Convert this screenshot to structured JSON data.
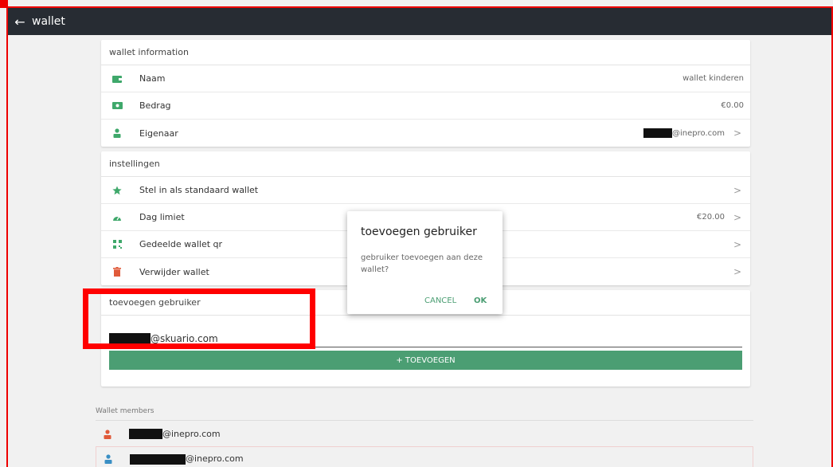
{
  "header": {
    "back_icon": "arrow-left-icon",
    "title": "wallet"
  },
  "wallet_info": {
    "title": "wallet information",
    "rows": [
      {
        "icon": "wallet-icon",
        "label": "Naam",
        "value": "wallet kinderen"
      },
      {
        "icon": "money-icon",
        "label": "Bedrag",
        "value": "€0.00"
      },
      {
        "icon": "user-icon",
        "label": "Eigenaar",
        "value": "@inepro.com",
        "chevron": ">"
      }
    ]
  },
  "settings": {
    "title": "instellingen",
    "rows": [
      {
        "icon": "star-icon",
        "label": "Stel in als standaard wallet",
        "value": "",
        "chevron": ">"
      },
      {
        "icon": "speedometer-icon",
        "label": "Dag limiet",
        "value": "€20.00",
        "chevron": ">"
      },
      {
        "icon": "qr-icon",
        "label": "Gedeelde wallet qr",
        "value": "",
        "chevron": ">"
      },
      {
        "icon": "trash-icon",
        "label": "Verwijder wallet",
        "value": "",
        "chevron": ">"
      }
    ]
  },
  "add_user": {
    "title": "toevoegen gebruiker",
    "input_value": "@skuario.com",
    "button_label": "+ TOEVOEGEN"
  },
  "members": {
    "title": "Wallet members",
    "items": [
      {
        "icon": "user-icon",
        "email": "@inepro.com",
        "color": "#e05a3a"
      },
      {
        "icon": "user-icon",
        "email": "@inepro.com",
        "color": "#3a8fc4"
      }
    ]
  },
  "dialog": {
    "title": "toevoegen gebruiker",
    "message": "gebruiker toevoegen aan deze wallet?",
    "cancel_label": "CANCEL",
    "ok_label": "OK"
  },
  "colors": {
    "topbar": "#272c33",
    "accent": "#4b9e73",
    "highlight": "#ff0000"
  }
}
